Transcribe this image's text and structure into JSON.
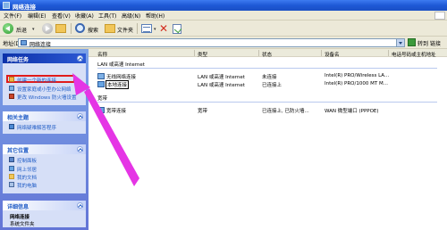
{
  "window": {
    "title": "网络连接"
  },
  "menu": [
    "文件(F)",
    "编辑(E)",
    "查看(V)",
    "收藏(A)",
    "工具(T)",
    "高级(N)",
    "帮助(H)"
  ],
  "toolbar": {
    "back_label": "后退",
    "search_label": "搜索",
    "folders_label": "文件夹"
  },
  "address": {
    "label": "地址(D)",
    "value": "网络连接",
    "go_label": "转到",
    "links_label": "链接"
  },
  "sidebar": {
    "network_tasks": {
      "title": "网络任务",
      "items": [
        "创建一个新的连接",
        "设置家庭或小型办公网络",
        "更改 Windows 防火墙设置"
      ]
    },
    "see_also": {
      "title": "相关主题",
      "items": [
        "网络疑难解答程序"
      ]
    },
    "other_places": {
      "title": "其它位置",
      "items": [
        "控制面板",
        "网上邻居",
        "我的文档",
        "我的电脑"
      ]
    },
    "details": {
      "title": "详细信息",
      "lines": [
        "网络连接",
        "系统文件夹"
      ]
    }
  },
  "columns": [
    "名称",
    "类型",
    "状态",
    "设备名",
    "电话号码或主机地址"
  ],
  "groups": [
    {
      "title": "LAN 或高速 Internet",
      "rows": [
        {
          "name": "无线网络连接",
          "type": "LAN 或高速 Internet",
          "status": "未连接",
          "device": "Intel(R) PRO/Wireless LA..."
        },
        {
          "name": "本地连接",
          "type": "LAN 或高速 Internet",
          "status": "已连接上",
          "device": "Intel(R) PRO/1000 MT M..."
        }
      ]
    },
    {
      "title": "宽带",
      "rows": [
        {
          "name": "宽带连接",
          "type": "宽带",
          "status": "已连接上, 已防火墙...",
          "device": "WAN 微型端口 (PPPOE)"
        }
      ]
    }
  ],
  "colors": {
    "titlebar": "#1e59d6",
    "highlight": "#e01b1b",
    "arrow": "#e535e5",
    "taskpane": "#7ba2e7"
  }
}
